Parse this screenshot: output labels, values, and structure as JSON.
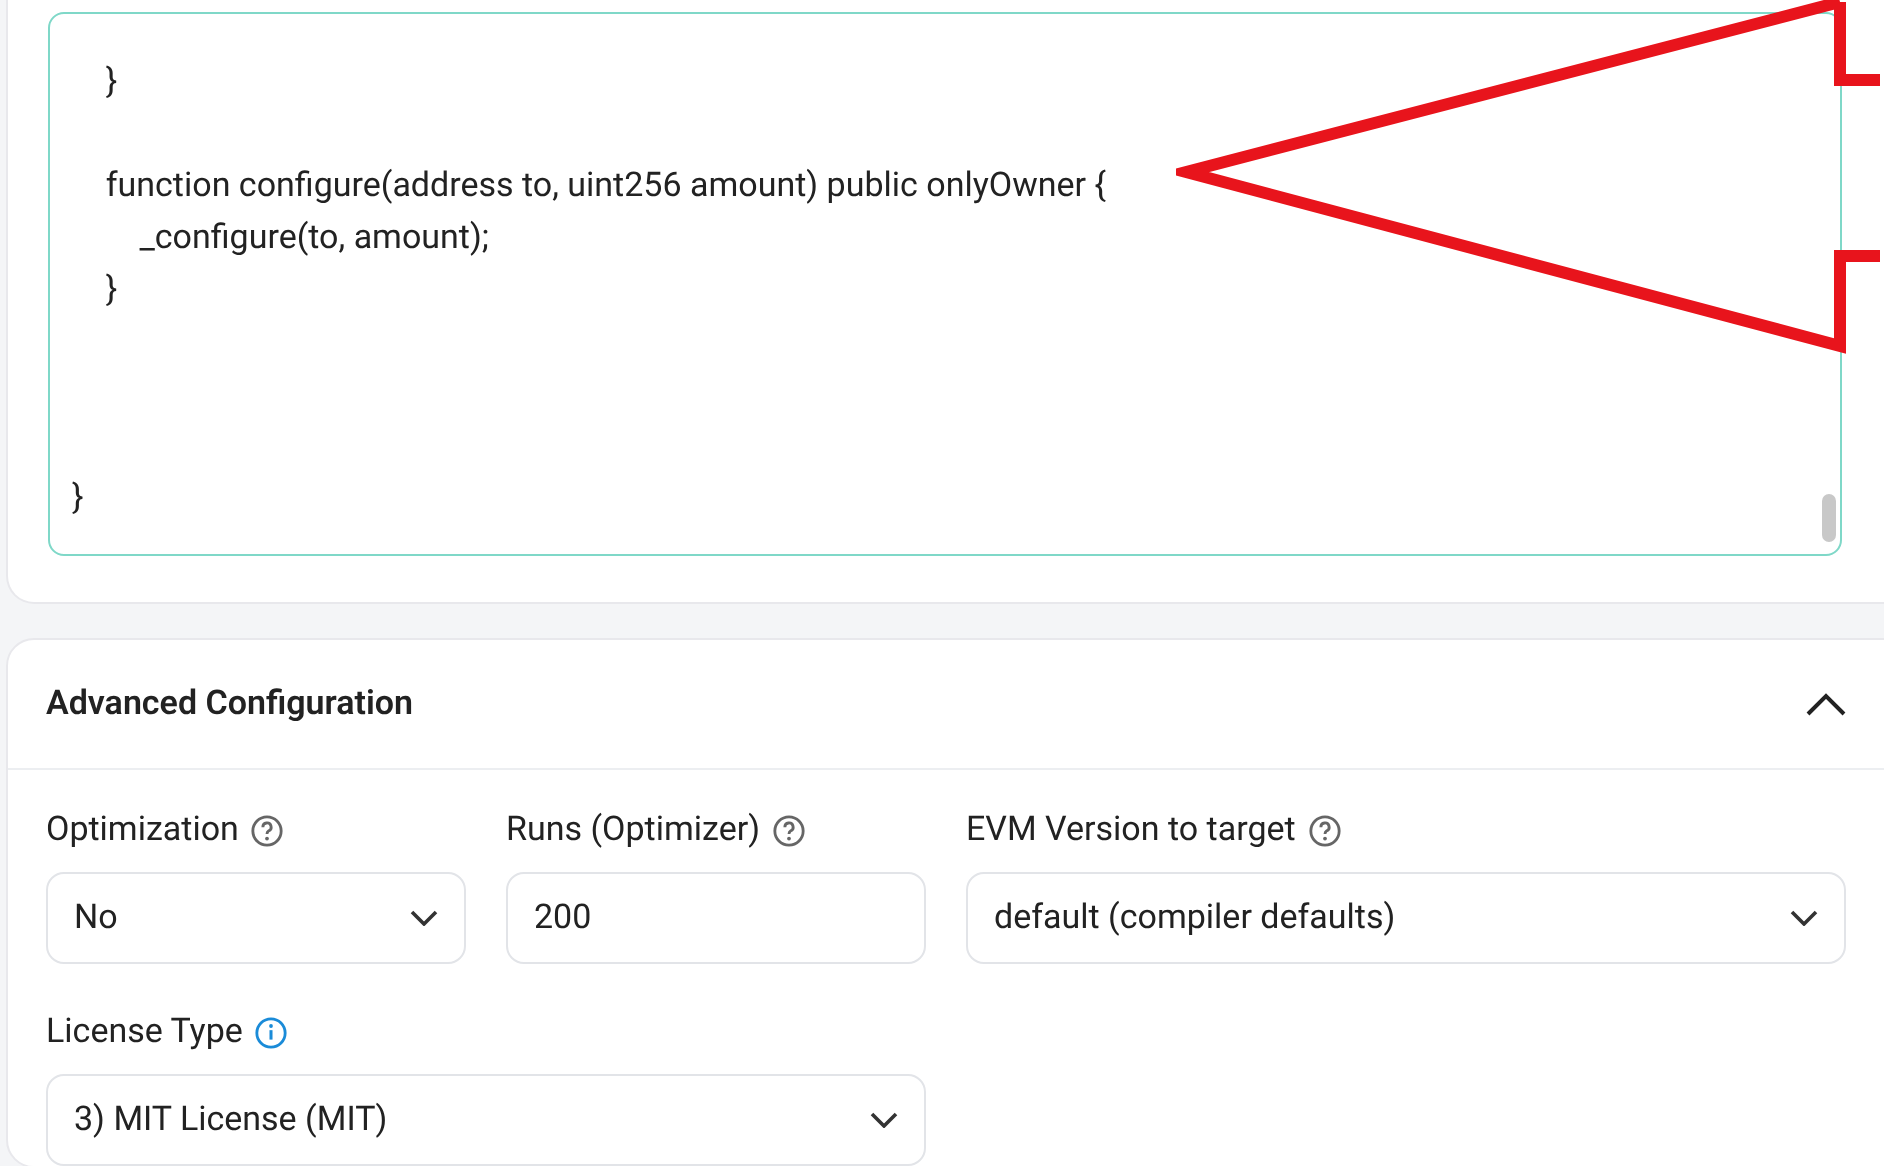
{
  "code_editor": {
    "lines": [
      {
        "text": "    }",
        "kind": "plain"
      },
      {
        "text": "    function configure(address to, uint256 amount) public onlyOwner {",
        "kind": "spaced"
      },
      {
        "text": "        _configure(to, amount);",
        "kind": "plain"
      },
      {
        "text": "    }",
        "kind": "plain"
      },
      {
        "text": "}",
        "kind": "trailing"
      }
    ]
  },
  "advanced": {
    "title": "Advanced Configuration",
    "expanded": true,
    "fields": [
      {
        "kind": "select",
        "label": "Optimization",
        "help_icon": true,
        "info_icon": false,
        "value": "No"
      },
      {
        "kind": "input",
        "label": "Runs (Optimizer)",
        "help_icon": true,
        "info_icon": false,
        "value": "200"
      },
      {
        "kind": "select",
        "label": "EVM Version to target",
        "help_icon": true,
        "info_icon": false,
        "value": "default (compiler defaults)"
      },
      {
        "kind": "select",
        "label": "License Type",
        "help_icon": false,
        "info_icon": true,
        "value": "3) MIT License (MIT)"
      }
    ]
  }
}
